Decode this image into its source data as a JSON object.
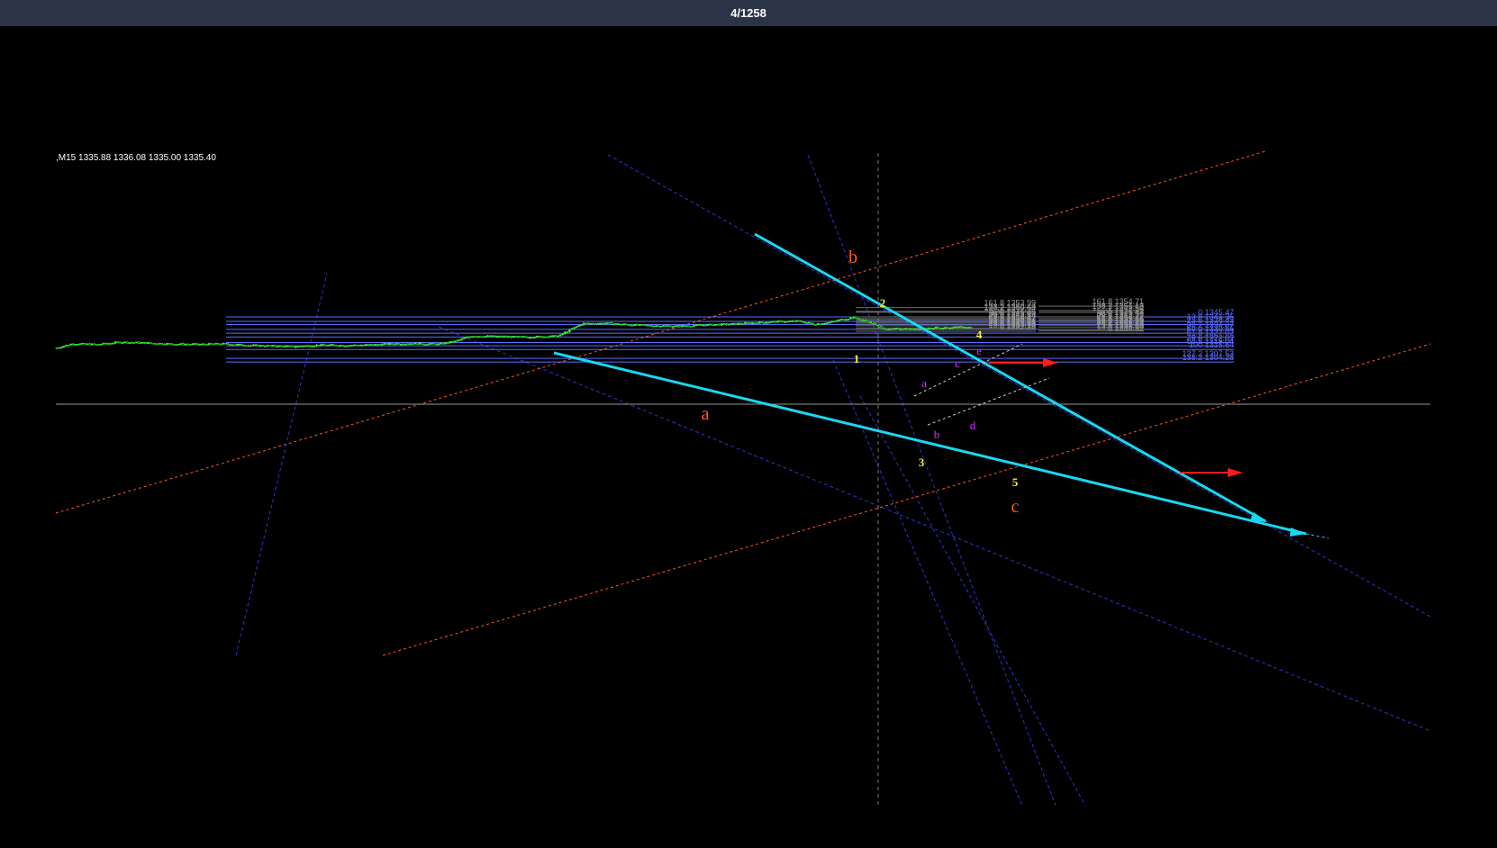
{
  "header": {
    "counter": "4/1258"
  },
  "chart_data": {
    "type": "candlestick",
    "symbol_info": ",M15  1335.88 1336.08 1335.00 1335.40",
    "timeframe": "M15",
    "ohlc": {
      "open": 1335.88,
      "high": 1336.08,
      "low": 1335.0,
      "close": 1335.4
    },
    "y_range": [
      1302,
      1357
    ],
    "colors": {
      "background": "#000000",
      "candles": "#33ee33",
      "trendlines": "#19d8f0",
      "fib_right": "#5b6cff",
      "fib_mid": "#b3b3b3",
      "channel": "#ff5522",
      "arrows": "#ff1a1a",
      "wave_major": "#ff5a22",
      "wave_minor": "#ffee33",
      "wave_sub": "#cc33ff"
    },
    "price_path": [
      [
        0.0,
        1317.2
      ],
      [
        0.02,
        1321.0
      ],
      [
        0.05,
        1320.2
      ],
      [
        0.08,
        1322.4
      ],
      [
        0.12,
        1321.4
      ],
      [
        0.15,
        1320.6
      ],
      [
        0.18,
        1320.3
      ],
      [
        0.21,
        1320.9
      ],
      [
        0.24,
        1319.5
      ],
      [
        0.27,
        1318.8
      ],
      [
        0.3,
        1318.4
      ],
      [
        0.33,
        1319.7
      ],
      [
        0.36,
        1319.4
      ],
      [
        0.4,
        1320.1
      ],
      [
        0.43,
        1321.2
      ],
      [
        0.46,
        1321.0
      ],
      [
        0.48,
        1320.5
      ],
      [
        0.5,
        1323.2
      ],
      [
        0.52,
        1328.0
      ],
      [
        0.55,
        1327.6
      ],
      [
        0.58,
        1327.0
      ],
      [
        0.61,
        1327.4
      ],
      [
        0.63,
        1328.0
      ],
      [
        0.64,
        1332.2
      ],
      [
        0.66,
        1339.4
      ],
      [
        0.69,
        1339.6
      ],
      [
        0.72,
        1338.2
      ],
      [
        0.75,
        1337.4
      ],
      [
        0.78,
        1337.0
      ],
      [
        0.81,
        1338.0
      ],
      [
        0.84,
        1338.7
      ],
      [
        0.87,
        1339.8
      ],
      [
        0.9,
        1341.0
      ],
      [
        0.93,
        1341.6
      ],
      [
        0.95,
        1338.8
      ],
      [
        0.97,
        1340.4
      ],
      [
        0.985,
        1343.2
      ],
      [
        1.0,
        1344.8
      ]
    ],
    "last_segment": [
      [
        0.0,
        1344.8
      ],
      [
        0.08,
        1342.0
      ],
      [
        0.15,
        1340.2
      ],
      [
        0.22,
        1335.8
      ],
      [
        0.3,
        1333.5
      ],
      [
        0.4,
        1334.9
      ],
      [
        0.5,
        1333.8
      ],
      [
        0.6,
        1334.9
      ],
      [
        0.7,
        1335.7
      ],
      [
        0.8,
        1335.0
      ],
      [
        0.9,
        1336.3
      ],
      [
        1.0,
        1335.4
      ]
    ],
    "fib_right": [
      {
        "label": "0 1345.47",
        "value": 1345.47
      },
      {
        "label": "13.8 1341.35",
        "value": 1341.35
      },
      {
        "label": "23.6 1338.43",
        "value": 1338.43
      },
      {
        "label": "38.2 1334.07",
        "value": 1334.07
      },
      {
        "label": "50.0 1330.55",
        "value": 1330.55
      },
      {
        "label": "61.8 1327.02",
        "value": 1327.02
      },
      {
        "label": "78.6 1322.02",
        "value": 1322.02
      },
      {
        "label": "88.6 1319.04",
        "value": 1319.04
      },
      {
        "label": "100 1315.64",
        "value": 1315.64
      },
      {
        "label": "127.2 1307.53",
        "value": 1307.53
      },
      {
        "label": "138.2 1304.25",
        "value": 1304.25
      }
    ],
    "fib_mid": [
      {
        "label": "161.8 1353.99",
        "value": 1353.99
      },
      {
        "label": "138.2 1350.49",
        "value": 1350.49
      },
      {
        "label": "127.2 1349.64",
        "value": 1349.64
      },
      {
        "label": "100 1345.45",
        "value": 1345.45
      },
      {
        "label": "88.6 1343.95",
        "value": 1343.95
      },
      {
        "label": "78.6 1342.64",
        "value": 1342.64
      },
      {
        "label": "61.8 1340.42",
        "value": 1340.42
      },
      {
        "label": "50.0 1338.87",
        "value": 1338.87
      },
      {
        "label": "38.2 1337.31",
        "value": 1337.31
      },
      {
        "label": "23.6 1335.39",
        "value": 1335.39
      },
      {
        "label": "13.8 1334.10",
        "value": 1334.1
      },
      {
        "label": "0 1332.28",
        "value": 1332.28
      }
    ],
    "fib_mid2": [
      {
        "label": "161.8 1354.71",
        "value": 1355.2
      },
      {
        "label": "138.2 1351.18",
        "value": 1351.18
      },
      {
        "label": "127.2 1349.54",
        "value": 1349.54
      },
      {
        "label": "100 1345.47",
        "value": 1345.47
      },
      {
        "label": "88.6 1343.76",
        "value": 1343.76
      },
      {
        "label": "78.6 1342.27",
        "value": 1342.27
      },
      {
        "label": "61.8 1339.76",
        "value": 1339.76
      },
      {
        "label": "50.0 1337.99",
        "value": 1337.99
      },
      {
        "label": "38.2 1336.23",
        "value": 1336.23
      },
      {
        "label": "23.6 1334.05",
        "value": 1334.05
      },
      {
        "label": "13.8 1332.58",
        "value": 1332.58
      },
      {
        "label": "0 1330.52",
        "value": 1330.52
      }
    ],
    "waves": {
      "major": [
        "a",
        "b",
        "c"
      ],
      "minor": [
        "1",
        "2",
        "3",
        "4",
        "5"
      ],
      "sub": [
        "a",
        "b",
        "c",
        "d",
        "e"
      ]
    }
  }
}
